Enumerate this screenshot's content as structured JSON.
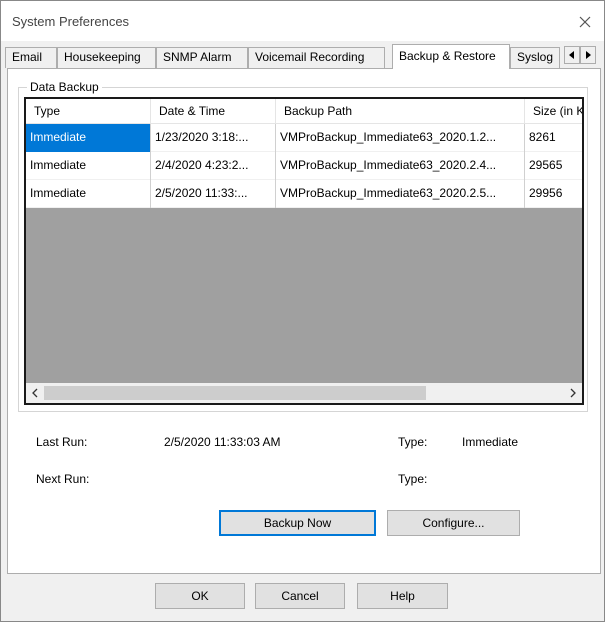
{
  "window": {
    "title": "System Preferences",
    "close_icon": "close-icon"
  },
  "tabs": [
    {
      "label": "Email",
      "active": false
    },
    {
      "label": "Housekeeping",
      "active": false
    },
    {
      "label": "SNMP Alarm",
      "active": false
    },
    {
      "label": "Voicemail Recording",
      "active": false
    },
    {
      "label": "Backup & Restore",
      "active": true
    },
    {
      "label": "Syslog",
      "active": false
    }
  ],
  "tab_scroll": {
    "left_icon": "triangle-left-icon",
    "right_icon": "triangle-right-icon"
  },
  "data_backup": {
    "legend": "Data Backup",
    "columns": [
      "Type",
      "Date & Time",
      "Backup Path",
      "Size (in K"
    ],
    "rows": [
      {
        "type": "Immediate",
        "datetime": "1/23/2020 3:18:...",
        "path": "VMProBackup_Immediate63_2020.1.2...",
        "size": "8261",
        "selected": true
      },
      {
        "type": "Immediate",
        "datetime": "2/4/2020 4:23:2...",
        "path": "VMProBackup_Immediate63_2020.2.4...",
        "size": "29565",
        "selected": false
      },
      {
        "type": "Immediate",
        "datetime": "2/5/2020 11:33:...",
        "path": "VMProBackup_Immediate63_2020.2.5...",
        "size": "29956",
        "selected": false
      }
    ],
    "scroll_left_icon": "chevron-left-icon",
    "scroll_right_icon": "chevron-right-icon"
  },
  "info": {
    "last_run_label": "Last Run:",
    "last_run_value": "2/5/2020 11:33:03 AM",
    "last_type_label": "Type:",
    "last_type_value": "Immediate",
    "next_run_label": "Next Run:",
    "next_type_label": "Type:"
  },
  "buttons": {
    "backup_now": "Backup Now",
    "configure": "Configure...",
    "ok": "OK",
    "cancel": "Cancel",
    "help": "Help"
  },
  "colors": {
    "selection": "#0078d7",
    "window_bg": "#f0f0f0",
    "list_empty_bg": "#a0a0a0"
  }
}
